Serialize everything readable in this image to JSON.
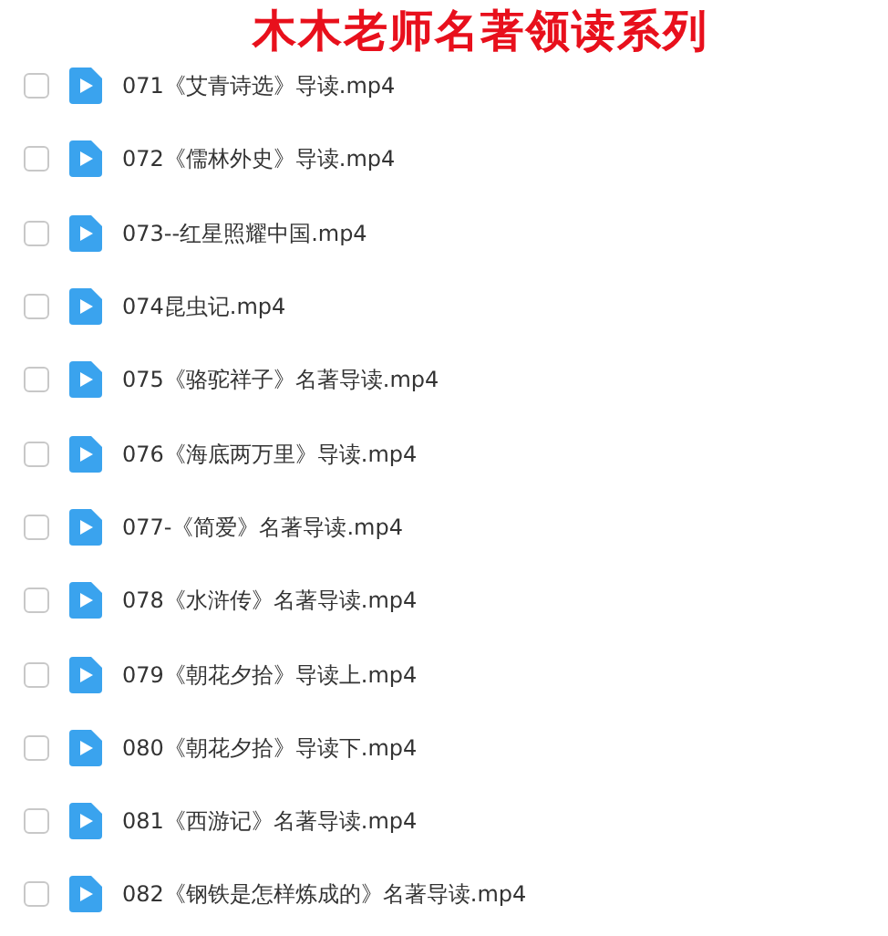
{
  "title": "木木老师名著领读系列",
  "files": [
    {
      "name": "071《艾青诗选》导读.mp4",
      "checked": false
    },
    {
      "name": "072《儒林外史》导读.mp4",
      "checked": false
    },
    {
      "name": "073--红星照耀中国.mp4",
      "checked": false
    },
    {
      "name": "074昆虫记.mp4",
      "checked": false
    },
    {
      "name": "075《骆驼祥子》名著导读.mp4",
      "checked": false
    },
    {
      "name": "076《海底两万里》导读.mp4",
      "checked": false
    },
    {
      "name": "077-《简爱》名著导读.mp4",
      "checked": false
    },
    {
      "name": "078《水浒传》名著导读.mp4",
      "checked": false
    },
    {
      "name": "079《朝花夕拾》导读上.mp4",
      "checked": false
    },
    {
      "name": "080《朝花夕拾》导读下.mp4",
      "checked": false
    },
    {
      "name": "081《西游记》名著导读.mp4",
      "checked": false
    },
    {
      "name": "082《钢铁是怎样炼成的》名著导读.mp4",
      "checked": false
    }
  ]
}
